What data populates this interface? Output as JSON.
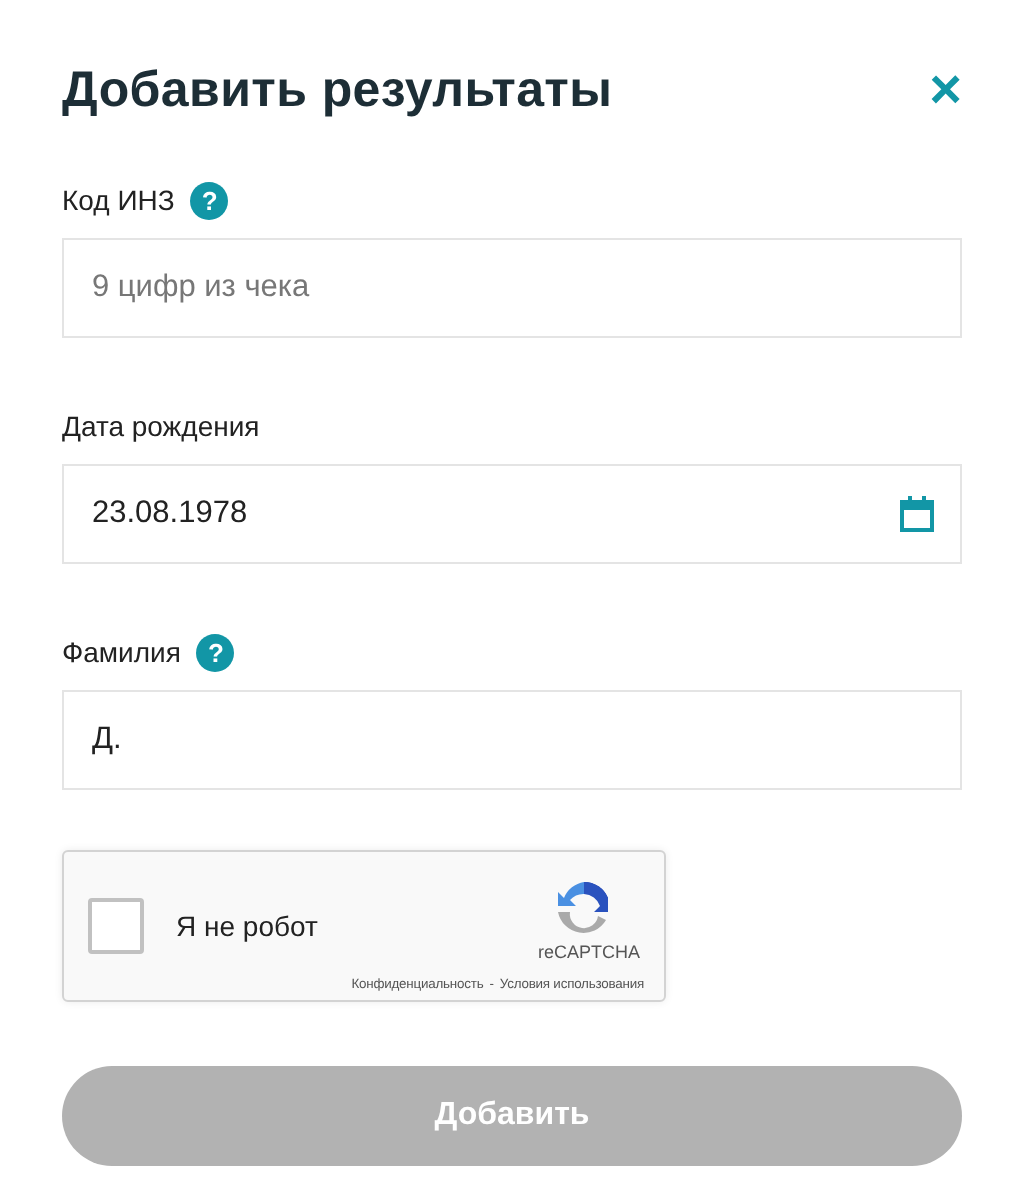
{
  "title": "Добавить результаты",
  "close": "×",
  "fields": [
    {
      "kind": "text",
      "label": "Код ИНЗ",
      "help_mark": "?",
      "placeholder": "9 цифр из чека"
    },
    {
      "kind": "date",
      "label": "Дата рождения",
      "value": "23.08.1978"
    },
    {
      "kind": "text",
      "label": "Фамилия",
      "help_mark": "?",
      "value": "Д."
    }
  ],
  "captcha": {
    "checked": false,
    "label": "Я не робот",
    "brand": "reCAPTCHA",
    "privacy": "Конфиденциальность",
    "separator": "-",
    "terms": "Условия использования"
  },
  "submit": {
    "label": "Добавить",
    "disabled": true
  }
}
